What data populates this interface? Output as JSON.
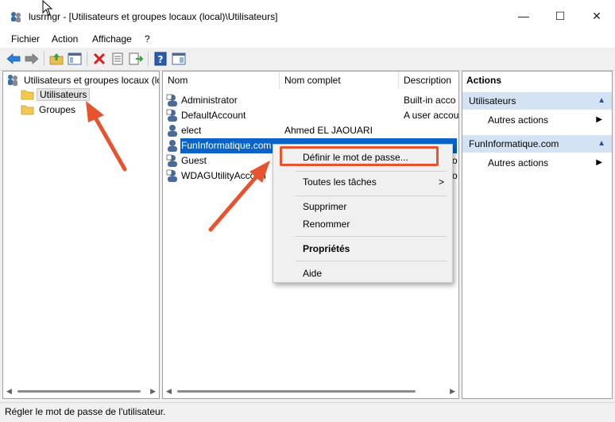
{
  "window": {
    "title": "lusrmgr - [Utilisateurs et groupes locaux (local)\\Utilisateurs]",
    "controls": {
      "minimize": "—",
      "maximize": "☐",
      "close": "✕"
    }
  },
  "menu": [
    "Fichier",
    "Action",
    "Affichage",
    "?"
  ],
  "toolbar": {
    "icons": [
      "back-icon",
      "forward-icon",
      "up-folder-icon",
      "show-hide-tree-icon",
      "delete-icon",
      "properties-icon",
      "export-icon",
      "help-icon",
      "view-icon"
    ]
  },
  "tree": {
    "root": "Utilisateurs et groupes locaux (lo",
    "children": [
      "Utilisateurs",
      "Groupes"
    ],
    "selected": "Utilisateurs"
  },
  "list": {
    "columns": [
      "Nom",
      "Nom complet",
      "Description"
    ],
    "rows": [
      {
        "name": "Administrator",
        "fullname": "",
        "description": "Built-in acco"
      },
      {
        "name": "DefaultAccount",
        "fullname": "",
        "description": "A user accou"
      },
      {
        "name": "elect",
        "fullname": "Ahmed EL JAOUARI",
        "description": ""
      },
      {
        "name": "FunInformatique.com",
        "fullname": "",
        "description": "",
        "selected": true
      },
      {
        "name": "Guest",
        "fullname": "",
        "description": "o"
      },
      {
        "name": "WDAGUtilityAccoun",
        "fullname": "",
        "description": "o"
      }
    ]
  },
  "context_menu": {
    "items": [
      {
        "label": "Définir le mot de passe...",
        "bold": false
      },
      {
        "label": "Toutes les tâches",
        "submenu": true
      },
      {
        "label": "Supprimer"
      },
      {
        "label": "Renommer"
      },
      {
        "label": "Propriétés",
        "bold": true
      },
      {
        "label": "Aide"
      }
    ],
    "submenu_arrow": ">"
  },
  "actions": {
    "title": "Actions",
    "sections": [
      {
        "header": "Utilisateurs",
        "item": "Autres actions"
      },
      {
        "header": "FunInformatique.com",
        "item": "Autres actions"
      }
    ]
  },
  "status": "Régler le mot de passe de l'utilisateur.",
  "colors": {
    "accent": "#0a64c8",
    "annotation": "#e8532f",
    "section_header": "#d4e3f3"
  }
}
